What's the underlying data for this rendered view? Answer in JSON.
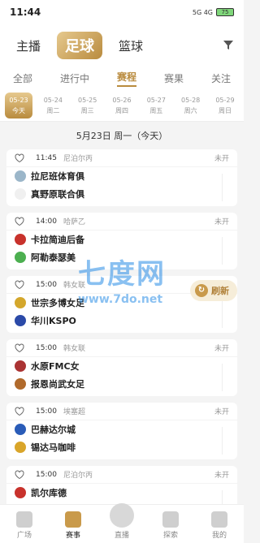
{
  "status": {
    "time": "11:44",
    "signal": "5G 4G",
    "battery": "75"
  },
  "topnav": {
    "tabs": [
      "主播",
      "足球",
      "篮球"
    ]
  },
  "subtabs": [
    "全部",
    "进行中",
    "赛程",
    "赛果",
    "关注"
  ],
  "dates": [
    {
      "d": "05-23",
      "w": "今天"
    },
    {
      "d": "05-24",
      "w": "周二"
    },
    {
      "d": "05-25",
      "w": "周三"
    },
    {
      "d": "05-26",
      "w": "周四"
    },
    {
      "d": "05-27",
      "w": "周五"
    },
    {
      "d": "05-28",
      "w": "周六"
    },
    {
      "d": "05-29",
      "w": "周日"
    }
  ],
  "day_header": "5月23日 周一（今天）",
  "matches": [
    {
      "time": "11:45",
      "league": "尼泊尔丙",
      "status": "未开",
      "home": "拉尼班体育俱",
      "away": "真野原联合俱",
      "hc": "#9bb6c9",
      "ac": "#f0f0f0"
    },
    {
      "time": "14:00",
      "league": "哈萨乙",
      "status": "未开",
      "home": "卡拉简迪后备",
      "away": "阿勒泰瑟美",
      "hc": "#c8322c",
      "ac": "#4caf50"
    },
    {
      "time": "15:00",
      "league": "韩女联",
      "status": "未开",
      "home": "世宗多博女足",
      "away": "华川KSPO",
      "hc": "#d4a72c",
      "ac": "#2b4aa8"
    },
    {
      "time": "15:00",
      "league": "韩女联",
      "status": "未开",
      "home": "水原FMC女",
      "away": "报恩尚武女足",
      "hc": "#a33",
      "ac": "#b06a2c"
    },
    {
      "time": "15:00",
      "league": "埃塞超",
      "status": "未开",
      "home": "巴赫达尔城",
      "away": "锡达马咖啡",
      "hc": "#2a5cb8",
      "ac": "#d9a52a"
    },
    {
      "time": "15:00",
      "league": "尼泊尔丙",
      "status": "未开",
      "home": "凯尔库德",
      "away": "",
      "hc": "#c8322c",
      "ac": "#fff"
    }
  ],
  "refresh_label": "刷新",
  "watermark": {
    "big": "七度网",
    "small": "www.7do.net"
  },
  "bottomnav": [
    "广场",
    "赛事",
    "直播",
    "探索",
    "我的"
  ]
}
